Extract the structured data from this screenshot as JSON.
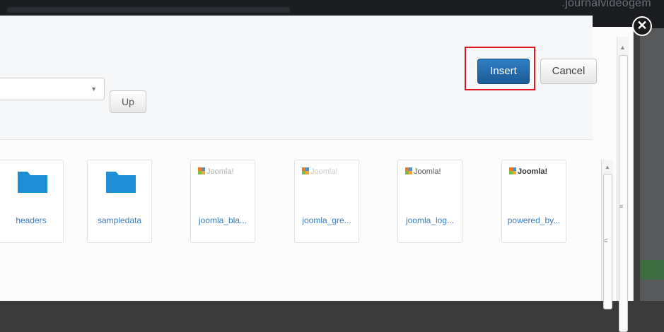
{
  "header": {
    "brand_text": ".journalvideogem"
  },
  "dialog": {
    "close_symbol": "✕",
    "insert_label": "Insert",
    "cancel_label": "Cancel",
    "folder_select_value": "",
    "up_label": "Up"
  },
  "files": [
    {
      "type": "folder",
      "name": "headers"
    },
    {
      "type": "folder",
      "name": "sampledata"
    },
    {
      "type": "image",
      "name": "joomla_bla...",
      "logo_text": "Joomla!"
    },
    {
      "type": "image",
      "name": "joomla_gre...",
      "logo_text": "Joomla!"
    },
    {
      "type": "image",
      "name": "joomla_log...",
      "logo_text": "Joomla!"
    },
    {
      "type": "image",
      "name": "powered_by...",
      "logo_text": "Joomla!"
    }
  ],
  "colors": {
    "accent_blue": "#1c5a97",
    "highlight_red": "#e0161f",
    "folder_blue": "#1e8fd6",
    "label_blue": "#3a7fc2"
  }
}
